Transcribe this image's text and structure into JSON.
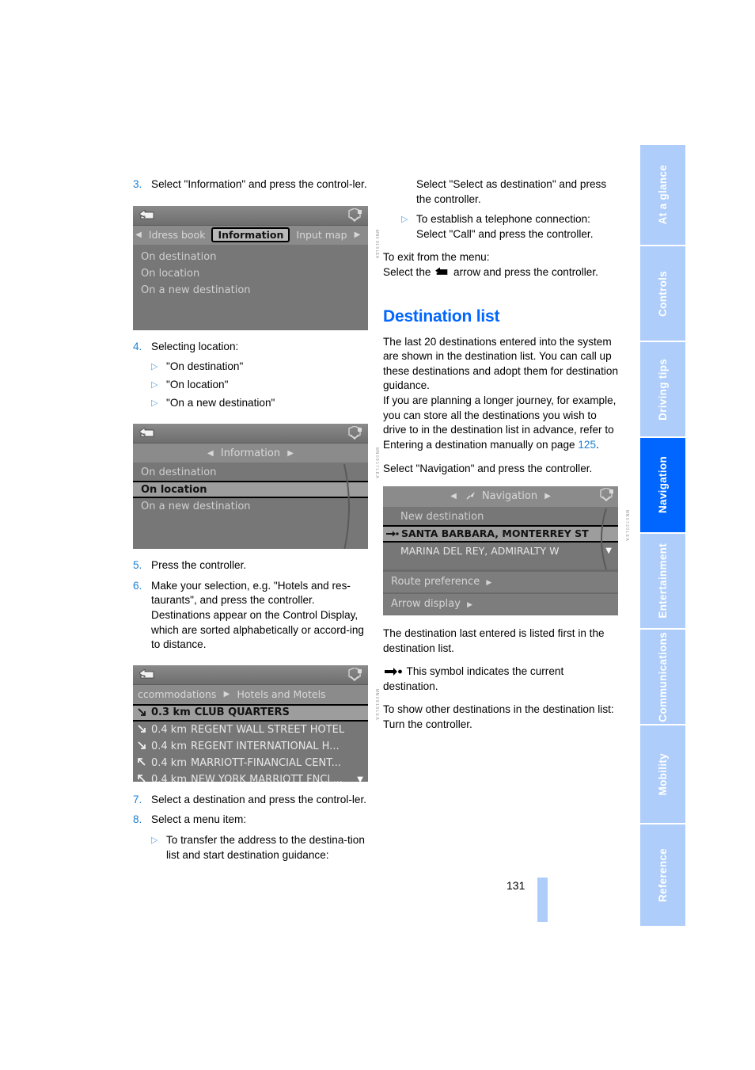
{
  "page": {
    "number": "131"
  },
  "sidebar": {
    "tabs": [
      {
        "label": "At a glance",
        "active": false
      },
      {
        "label": "Controls",
        "active": false
      },
      {
        "label": "Driving tips",
        "active": false
      },
      {
        "label": "Navigation",
        "active": true
      },
      {
        "label": "Entertainment",
        "active": false
      },
      {
        "label": "Communications",
        "active": false
      },
      {
        "label": "Mobility",
        "active": false
      },
      {
        "label": "Reference",
        "active": false
      }
    ]
  },
  "colors": {
    "accent_blue": "#0066ff",
    "tab_inactive": "#aecdfa",
    "number_blue": "#1a7fd4",
    "link_blue": "#1a7fd4"
  },
  "left_column": {
    "step3": {
      "num": "3.",
      "text": "Select \"Information\" and press the control-ler."
    },
    "shot1": {
      "tabs": [
        {
          "label": "ldress book",
          "selected": false
        },
        {
          "label": "Information",
          "selected": true
        },
        {
          "label": "Input map",
          "selected": false
        }
      ],
      "items": [
        {
          "label": "On destination",
          "highlighted": false
        },
        {
          "label": "On location",
          "highlighted": false
        },
        {
          "label": "On a new destination",
          "highlighted": false
        }
      ]
    },
    "step4": {
      "num": "4.",
      "text": "Selecting location:",
      "bullets": [
        "\"On destination\"",
        "\"On location\"",
        "\"On a new destination\""
      ]
    },
    "shot2": {
      "title": "Information",
      "items": [
        {
          "label": "On destination",
          "highlighted": false
        },
        {
          "label": "On location",
          "highlighted": true
        },
        {
          "label": "On a new destination",
          "highlighted": false
        }
      ]
    },
    "step5": {
      "num": "5.",
      "text": "Press the controller."
    },
    "step6": {
      "num": "6.",
      "text": "Make your selection, e.g. \"Hotels and res-taurants\", and press the controller. Destinations appear on the Control Display, which are sorted alphabetically or accord-ing to distance."
    },
    "shot3": {
      "breadcrumb_left": "ccommodations",
      "breadcrumb_right": "Hotels and Motels",
      "items": [
        {
          "icon": "arrow-down-right",
          "distance": "0.3 km",
          "label": "CLUB QUARTERS",
          "highlighted": true
        },
        {
          "icon": "arrow-down-right",
          "distance": "0.4 km",
          "label": "REGENT WALL STREET HOTEL",
          "highlighted": false
        },
        {
          "icon": "arrow-down-right",
          "distance": "0.4 km",
          "label": "REGENT INTERNATIONAL H...",
          "highlighted": false
        },
        {
          "icon": "arrow-up-left",
          "distance": "0.4 km",
          "label": "MARRIOTT-FINANCIAL CENT...",
          "highlighted": false
        },
        {
          "icon": "arrow-up-left",
          "distance": "0.4 km",
          "label": "NEW YORK MARRIOTT FNCL...",
          "highlighted": false
        }
      ]
    },
    "step7": {
      "num": "7.",
      "text": "Select a destination and press the control-ler."
    },
    "step8": {
      "num": "8.",
      "text": "Select a menu item:",
      "bullets": [
        "To transfer the address to the destina-tion list and start destination guidance:"
      ]
    }
  },
  "right_column": {
    "cont_text": "Select \"Select as destination\" and press the controller.",
    "bullet1": "To establish a telephone connection: Select \"Call\" and press the controller.",
    "exit_line1": "To exit from the menu:",
    "exit_line2_a": "Select the",
    "exit_line2_b": "arrow and press the controller.",
    "section_title": "Destination list",
    "para1": "The last 20 destinations entered into the system are shown in the destination list. You can call up these destinations and adopt them for destination guidance.",
    "para2_a": "If you are planning a longer journey, for example, you can store all the destinations you wish to drive to in the destination list in advance, refer to Entering a destination manually on page",
    "para2_pageref": "125",
    "para2_b": ".",
    "para3": "Select \"Navigation\" and press the controller.",
    "shot4": {
      "title": "Navigation",
      "items": [
        {
          "label": "New destination",
          "highlighted": false,
          "current": false
        },
        {
          "label": "SANTA BARBARA, MONTERREY ST",
          "highlighted": true,
          "current": true
        },
        {
          "label": "MARINA DEL REY, ADMIRALTY W",
          "highlighted": false,
          "current": false
        }
      ],
      "menu_items": [
        "Route preference",
        "Arrow display"
      ]
    },
    "para4": "The destination last entered is listed first in the destination list.",
    "para5_a": "This symbol indicates the current destination.",
    "para6": "To show other destinations in the destination list:",
    "para7": "Turn the controller."
  }
}
